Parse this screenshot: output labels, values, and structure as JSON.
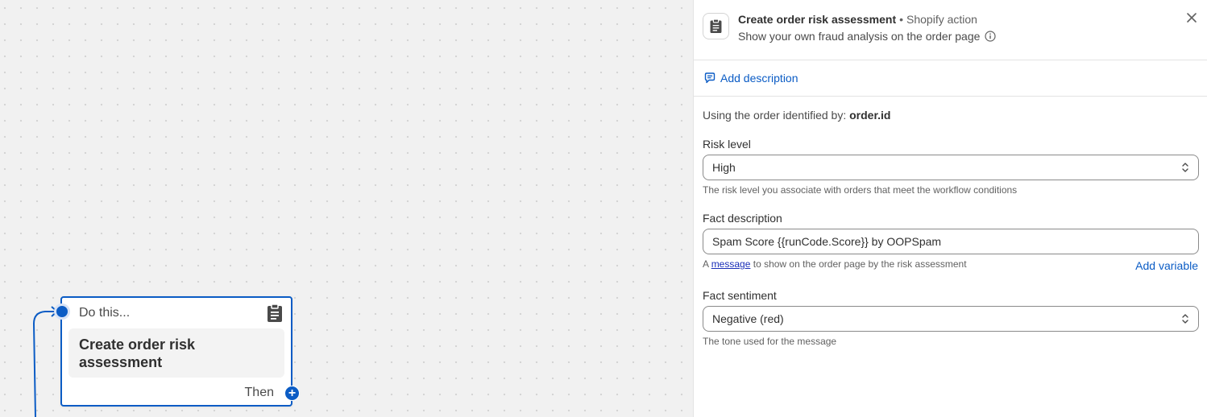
{
  "canvas": {
    "node": {
      "header": "Do this...",
      "title": "Create order risk assessment",
      "footer": "Then",
      "add_symbol": "+",
      "icon": "clipboard-icon"
    }
  },
  "panel": {
    "title": "Create order risk assessment",
    "separator": "•",
    "type": "Shopify action",
    "subtitle": "Show your own fraud analysis on the order page",
    "add_description_label": "Add description",
    "using_prefix": "Using the order identified by:",
    "using_value": "order.id",
    "fields": {
      "risk_level": {
        "label": "Risk level",
        "value": "High",
        "help": "The risk level you associate with orders that meet the workflow conditions"
      },
      "fact_description": {
        "label": "Fact description",
        "value": "Spam Score {{runCode.Score}} by OOPSpam",
        "help_prefix": "A",
        "help_link": "message",
        "help_suffix": "to show on the order page by the risk assessment",
        "add_variable": "Add variable"
      },
      "fact_sentiment": {
        "label": "Fact sentiment",
        "value": "Negative (red)",
        "help": "The tone used for the message"
      }
    }
  },
  "colors": {
    "accent": "#0b5cc5",
    "canvas_bg": "#f1f1f1",
    "panel_bg": "#ffffff"
  }
}
